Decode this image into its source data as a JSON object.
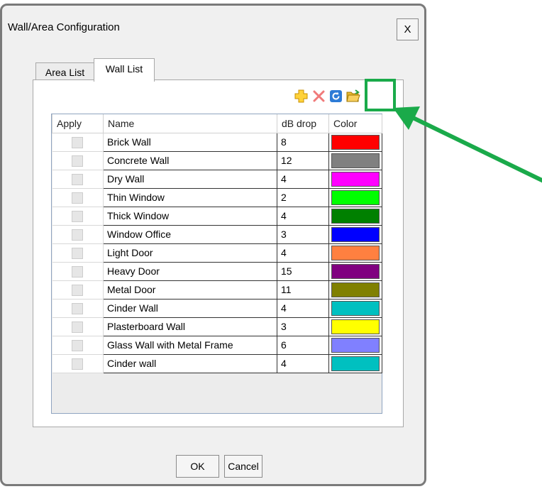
{
  "window": {
    "title": "Wall/Area Configuration",
    "close_label": "X"
  },
  "tabs": [
    {
      "label": "Area List"
    },
    {
      "label": "Wall List"
    }
  ],
  "toolbar": {
    "add_icon": "plus-icon",
    "delete_icon": "red-x-icon",
    "refresh_icon": "refresh-icon",
    "open_icon": "open-folder-icon"
  },
  "table": {
    "headers": {
      "apply": "Apply",
      "name": "Name",
      "db": "dB drop",
      "color": "Color"
    },
    "rows": [
      {
        "name": "Brick Wall",
        "db": "8",
        "color": "#ff0000"
      },
      {
        "name": "Concrete Wall",
        "db": "12",
        "color": "#808080"
      },
      {
        "name": "Dry Wall",
        "db": "4",
        "color": "#ff00ff"
      },
      {
        "name": "Thin Window",
        "db": "2",
        "color": "#00ff00"
      },
      {
        "name": "Thick Window",
        "db": "4",
        "color": "#008000"
      },
      {
        "name": "Window Office",
        "db": "3",
        "color": "#0000ff"
      },
      {
        "name": "Light Door",
        "db": "4",
        "color": "#ff8040"
      },
      {
        "name": "Heavy Door",
        "db": "15",
        "color": "#800080"
      },
      {
        "name": "Metal Door",
        "db": "11",
        "color": "#808000"
      },
      {
        "name": "Cinder Wall",
        "db": "4",
        "color": "#00c0c0"
      },
      {
        "name": "Plasterboard Wall",
        "db": "3",
        "color": "#ffff00"
      },
      {
        "name": "Glass Wall with Metal Frame",
        "db": "6",
        "color": "#8080ff"
      },
      {
        "name": "Cinder wall",
        "db": "4",
        "color": "#00c0c0"
      }
    ]
  },
  "buttons": {
    "ok": "OK",
    "cancel": "Cancel"
  },
  "annotation": {
    "color": "#1aaa4a"
  }
}
